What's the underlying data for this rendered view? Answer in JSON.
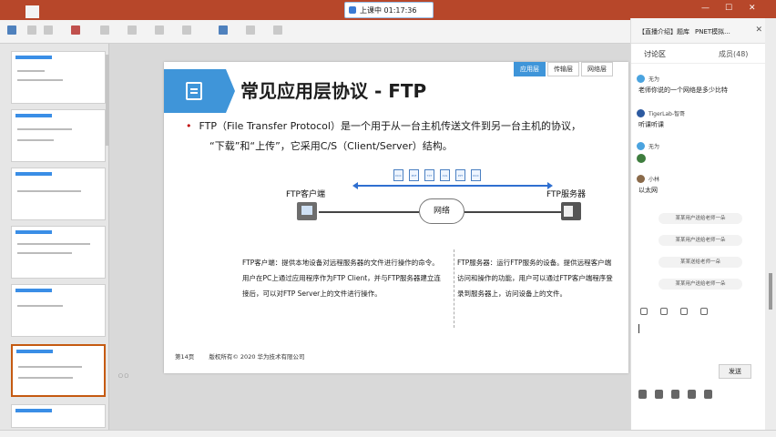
{
  "ribbon": {
    "tabs": [
      "",
      "",
      "",
      "",
      "",
      "",
      "",
      "",
      ""
    ],
    "active_index": 1
  },
  "timer": {
    "text": "上课中 01:17:36"
  },
  "slide": {
    "title": "常见应用层协议 - FTP",
    "nav_tabs": [
      "应用层",
      "传输层",
      "网络层"
    ],
    "bullet_line1": "FTP（File Transfer Protocol）是一个用于从一台主机传送文件到另一台主机的协议，",
    "bullet_line2": "“下载”和“上传”，它采用C/S（Client/Server）结构。",
    "label_client": "FTP客户端",
    "label_server": "FTP服务器",
    "network_label": "网络",
    "file_icons": [
      "DOC",
      "PDF",
      "TXT",
      "XLS",
      "PPT",
      "DOC"
    ],
    "client_desc": "FTP客户端：提供本地设备对远程服务器的文件进行操作的命令。用户在PC上通过应用程序作为FTP Client，并与FTP服务器建立连接后，可以对FTP Server上的文件进行操作。",
    "server_desc": "FTP服务器：运行FTP服务的设备。提供远程客户端访问和操作的功能，用户可以通过FTP客户端程序登录到服务器上，访问设备上的文件。",
    "page": "第14页",
    "copyright": "版权所有© 2020 华为技术有限公司"
  },
  "chat": {
    "header_left": "【直播介绍】题库",
    "header_right": "PNET模拟...",
    "tab_discussion": "讨论区",
    "tab_members": "成员(48)",
    "messages": [
      {
        "user": "无为",
        "text": "老师你说的一个网络是多少比特"
      },
      {
        "user": "TigerLab-智哥",
        "text": "听课听课"
      },
      {
        "user": "无为",
        "text": ""
      },
      {
        "user": "小林",
        "text": "以太网"
      }
    ],
    "gifts": [
      "某某用户送给老师一朵",
      "某某用户送给老师一朵",
      "某某送给老师一朵",
      "某某用户送给老师一朵"
    ],
    "send_label": "发送"
  }
}
